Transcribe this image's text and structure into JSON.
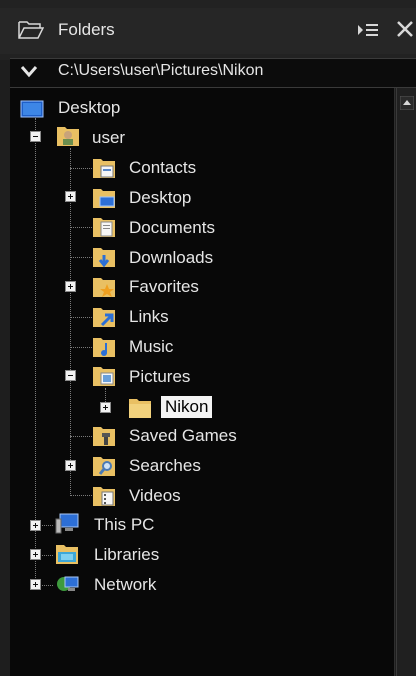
{
  "panel": {
    "title": "Folders",
    "icons": {
      "folder": "folder-outline-icon",
      "options": "list-options-icon",
      "close": "close-icon"
    }
  },
  "path_bar": {
    "path": "C:\\Users\\user\\Pictures\\Nikon",
    "icon": "chevron-down-icon"
  },
  "tree": {
    "items": [
      {
        "id": "desktop-root",
        "label": "Desktop",
        "icon": "desktop-icon",
        "expander": "none",
        "selected": false
      },
      {
        "id": "user",
        "label": "user",
        "icon": "user-folder-icon",
        "expander": "minus",
        "selected": false
      },
      {
        "id": "contacts",
        "label": "Contacts",
        "icon": "contacts-folder-icon",
        "expander": "none",
        "selected": false
      },
      {
        "id": "desktop-user",
        "label": "Desktop",
        "icon": "desktop-folder-icon",
        "expander": "plus",
        "selected": false
      },
      {
        "id": "documents",
        "label": "Documents",
        "icon": "documents-folder-icon",
        "expander": "none",
        "selected": false
      },
      {
        "id": "downloads",
        "label": "Downloads",
        "icon": "downloads-folder-icon",
        "expander": "none",
        "selected": false
      },
      {
        "id": "favorites",
        "label": "Favorites",
        "icon": "favorites-folder-icon",
        "expander": "plus",
        "selected": false
      },
      {
        "id": "links",
        "label": "Links",
        "icon": "links-folder-icon",
        "expander": "none",
        "selected": false
      },
      {
        "id": "music",
        "label": "Music",
        "icon": "music-folder-icon",
        "expander": "none",
        "selected": false
      },
      {
        "id": "pictures",
        "label": "Pictures",
        "icon": "pictures-folder-icon",
        "expander": "minus",
        "selected": false
      },
      {
        "id": "nikon",
        "label": "Nikon",
        "icon": "folder-icon",
        "expander": "plus",
        "selected": true
      },
      {
        "id": "saved-games",
        "label": "Saved Games",
        "icon": "saved-games-folder-icon",
        "expander": "none",
        "selected": false
      },
      {
        "id": "searches",
        "label": "Searches",
        "icon": "searches-folder-icon",
        "expander": "plus",
        "selected": false
      },
      {
        "id": "videos",
        "label": "Videos",
        "icon": "videos-folder-icon",
        "expander": "none",
        "selected": false
      },
      {
        "id": "this-pc",
        "label": "This PC",
        "icon": "computer-icon",
        "expander": "plus",
        "selected": false
      },
      {
        "id": "libraries",
        "label": "Libraries",
        "icon": "libraries-icon",
        "expander": "plus",
        "selected": false
      },
      {
        "id": "network",
        "label": "Network",
        "icon": "network-icon",
        "expander": "plus",
        "selected": false
      }
    ]
  },
  "colors": {
    "background": "#080808",
    "header": "#262626",
    "text": "#e6e6e6",
    "folder_yellow": "#e9c063",
    "selection_bg": "#f4f4f4"
  }
}
